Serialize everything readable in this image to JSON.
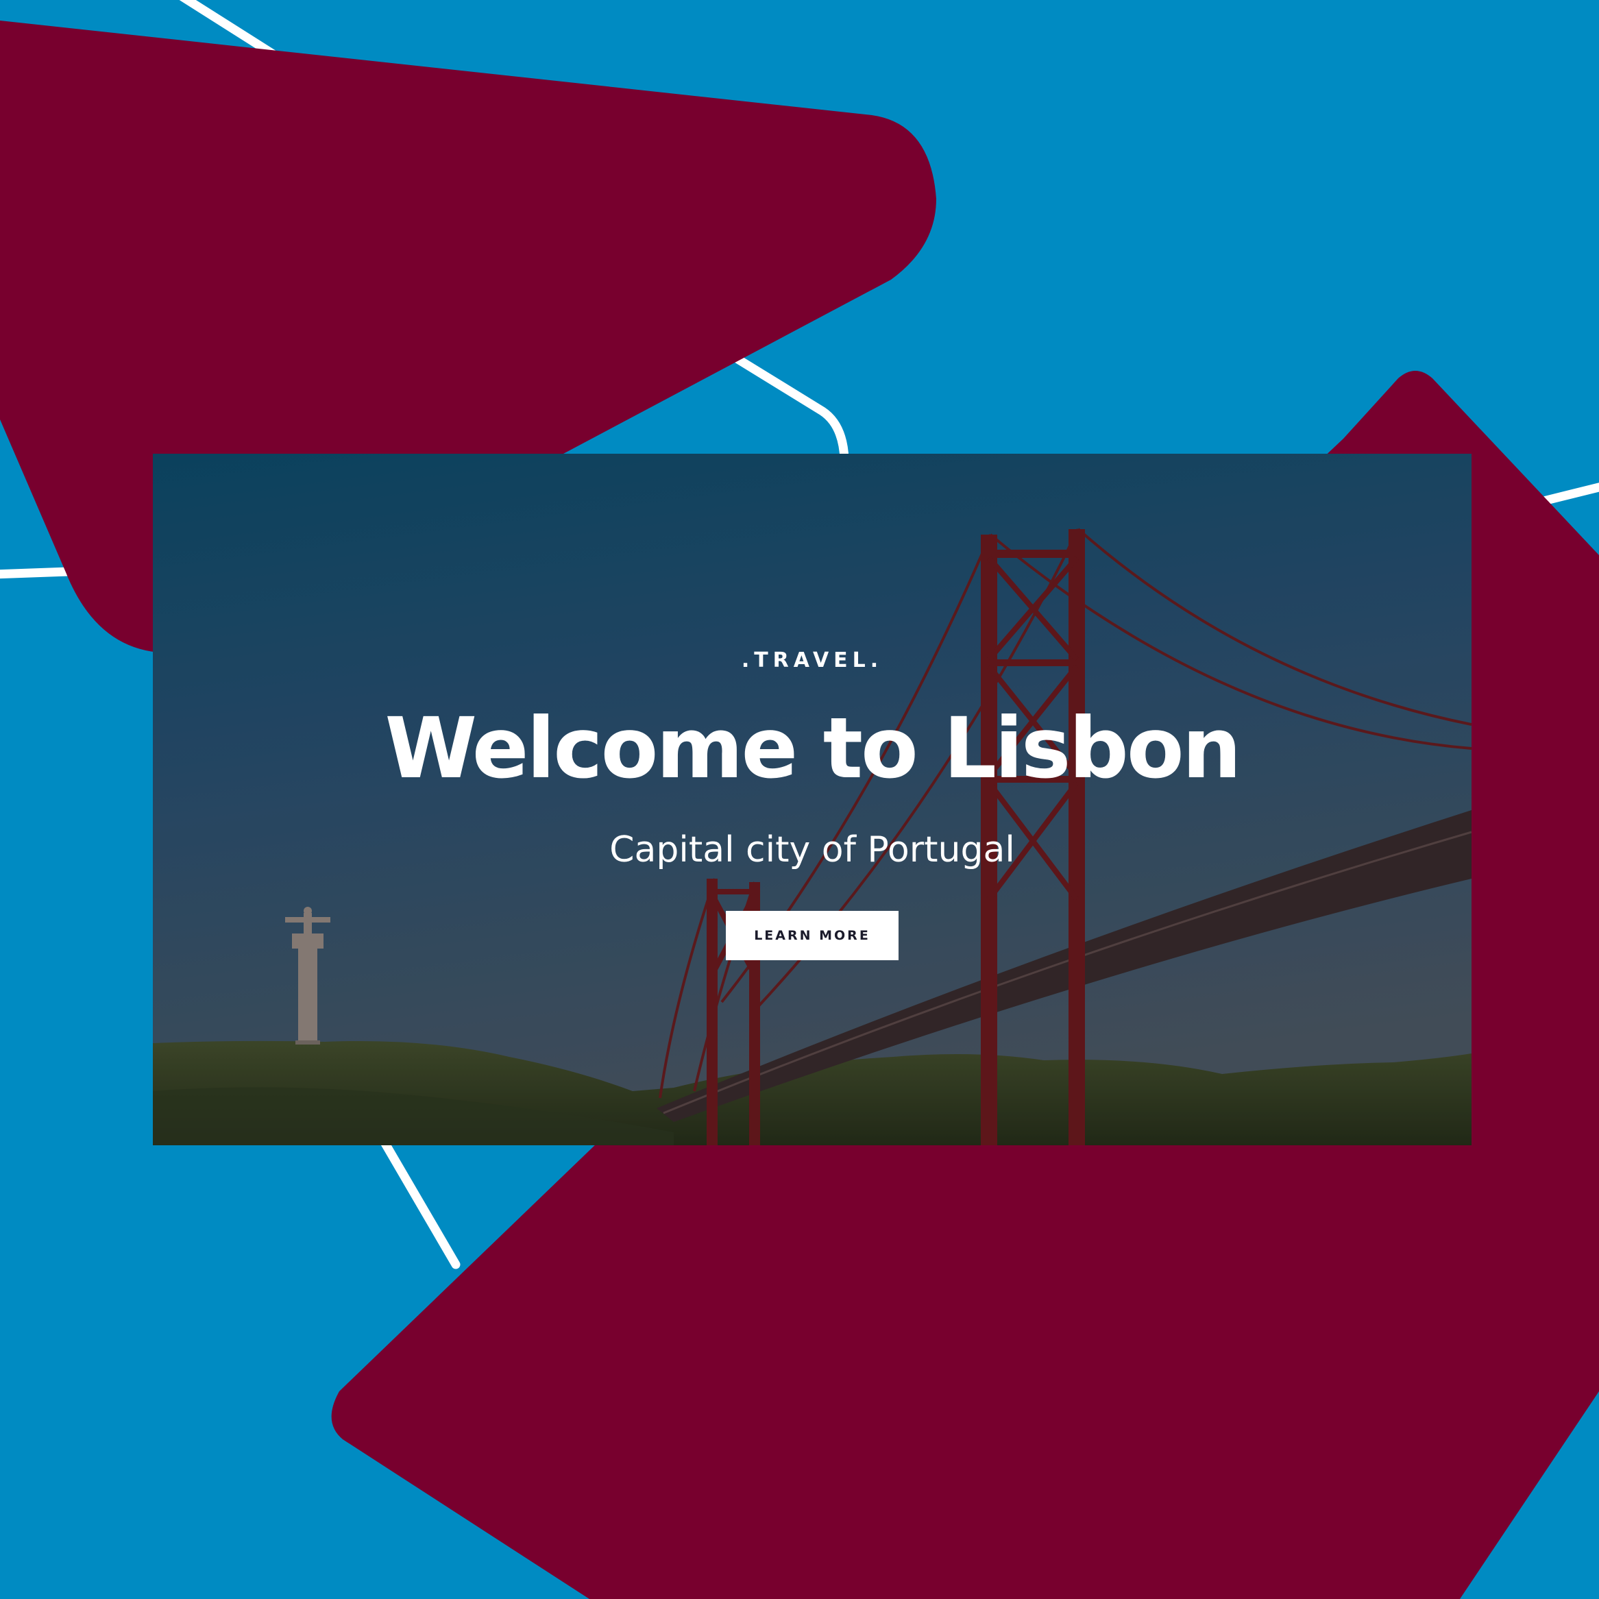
{
  "hero": {
    "eyebrow": ".TRAVEL.",
    "title": "Welcome to Lisbon",
    "subtitle": "Capital city of Portugal",
    "cta_label": "LEARN MORE"
  },
  "colors": {
    "background_blue": "#008bc2",
    "accent_burgundy": "#78002e",
    "outline_white": "#ffffff",
    "bridge_red": "#7a1f22"
  },
  "icons": {
    "landmark_statue": "cristo-rei-icon",
    "bridge": "suspension-bridge-icon"
  }
}
